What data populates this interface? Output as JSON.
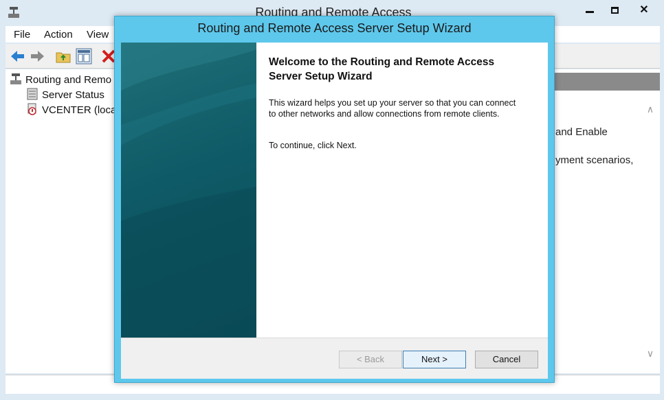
{
  "main_window": {
    "title": "Routing and Remote Access",
    "menu": [
      "File",
      "Action",
      "View"
    ],
    "tree": {
      "root": "Routing and Remo",
      "items": [
        "Server Status",
        "VCENTER (loca"
      ]
    },
    "right_pane": {
      "text_lines": [
        "and Enable",
        "yment scenarios,"
      ]
    }
  },
  "wizard": {
    "title": "Routing and Remote Access Server Setup Wizard",
    "heading": "Welcome to the Routing and Remote Access Server Setup Wizard",
    "description": "This wizard helps you set up your server so that you can connect to other networks and allow connections from remote clients.",
    "continue_text": "To continue, click Next.",
    "buttons": {
      "back": "< Back",
      "next": "Next >",
      "cancel": "Cancel"
    }
  },
  "colors": {
    "wizard_frame": "#5ec8ec",
    "side_panel": "#0e5a66"
  },
  "icons": [
    "app-icon",
    "back-arrow-icon",
    "forward-arrow-icon",
    "folder-up-icon",
    "show-hide-icon",
    "delete-icon",
    "server-icon",
    "server-status-icon",
    "server-error-icon",
    "scroll-up-icon",
    "scroll-down-icon"
  ]
}
